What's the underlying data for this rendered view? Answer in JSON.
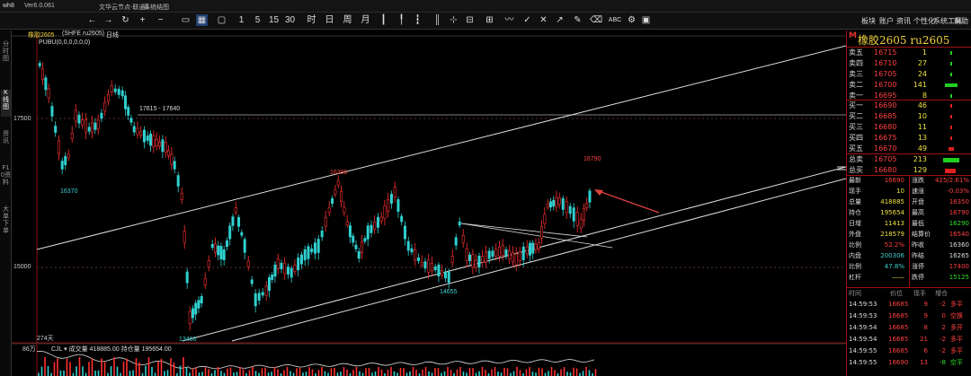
{
  "topbar": {
    "title": "wh8",
    "version": "Ver6.0.061",
    "menus": [
      "文华云节点-联通3",
      "系统结图"
    ]
  },
  "toolbar": {
    "right_menu": [
      "板块",
      "账户",
      "资讯",
      "个性化",
      "系统工具",
      "帮助"
    ]
  },
  "sidebar": {
    "tabs": [
      "分时图",
      "K线图",
      "资讯",
      "F10资料",
      "大单下单"
    ]
  },
  "chart": {
    "header": "橡胶2605",
    "header_code": "(SHFE ru2605)",
    "period": "日线",
    "indicator": "PUBU(0,0,0,0,0,0)",
    "price_labels": [
      "17500",
      "15000"
    ],
    "annotations": {
      "resistance": "17615 - 17640",
      "low_left": "16370",
      "high_mid": "16390",
      "low_mid": "14655",
      "high_right": "16790",
      "low_bottom": "13460"
    },
    "bottom_label": "274天",
    "volume_header": "86万",
    "volume_info": "CJL ▾ 成交量 418885.00  持仓量 195654.00"
  },
  "chart_data": {
    "type": "candlestick",
    "title": "橡胶2605",
    "x": [],
    "y_labels": [
      "17500",
      "15000"
    ],
    "annotations": [
      "17615 - 17640",
      "16370",
      "16390",
      "14655",
      "16790",
      "13460"
    ]
  },
  "panel": {
    "marker": "M",
    "title": "橡胶2605 ru2605",
    "asks": [
      {
        "label": "卖五",
        "price": "16715",
        "vol": "1"
      },
      {
        "label": "卖四",
        "price": "16710",
        "vol": "27"
      },
      {
        "label": "卖三",
        "price": "16705",
        "vol": "24"
      },
      {
        "label": "卖二",
        "price": "16700",
        "vol": "141"
      },
      {
        "label": "卖一",
        "price": "16695",
        "vol": "8"
      }
    ],
    "bids": [
      {
        "label": "买一",
        "price": "16690",
        "vol": "46"
      },
      {
        "label": "买二",
        "price": "16685",
        "vol": "10"
      },
      {
        "label": "买三",
        "price": "16680",
        "vol": "11"
      },
      {
        "label": "买四",
        "price": "16675",
        "vol": "13"
      },
      {
        "label": "买五",
        "price": "16670",
        "vol": "49"
      }
    ],
    "totals": [
      {
        "label": "总卖",
        "price": "16705",
        "vol": "213"
      },
      {
        "label": "总买",
        "price": "16680",
        "vol": "129"
      }
    ],
    "quote": [
      {
        "l1": "最新",
        "v1": "16690",
        "l2": "涨跌",
        "v2": "425/2.61%"
      },
      {
        "l1": "现手",
        "v1": "10",
        "l2": "速涨",
        "v2": "-0.03%"
      },
      {
        "l1": "总量",
        "v1": "418885",
        "l2": "开盘",
        "v2": "16350"
      },
      {
        "l1": "持仓",
        "v1": "195654",
        "l2": "最高",
        "v2": "16790"
      },
      {
        "l1": "日增",
        "v1": "11413",
        "l2": "最低",
        "v2": "16290"
      },
      {
        "l1": "外盘",
        "v1": "218579",
        "l2": "结算价",
        "v2": "16540"
      },
      {
        "l1": "比例",
        "v1": "52.2%",
        "l2": "昨收",
        "v2": "16360"
      },
      {
        "l1": "内盘",
        "v1": "200306",
        "l2": "昨结",
        "v2": "16265"
      },
      {
        "l1": "比例",
        "v1": "47.8%",
        "l2": "涨停",
        "v2": "17400"
      },
      {
        "l1": "杠杆",
        "v1": "——",
        "l2": "跌停",
        "v2": "15125"
      }
    ],
    "trades_header": [
      "时间",
      "价位",
      "现手",
      "增仓"
    ],
    "trades": [
      {
        "time": "14:59:53",
        "price": "16685",
        "vol": "9",
        "chg": "-2",
        "type": "多平"
      },
      {
        "time": "14:59:53",
        "price": "16685",
        "vol": "9",
        "chg": "0",
        "type": "空换"
      },
      {
        "time": "14:59:54",
        "price": "16685",
        "vol": "8",
        "chg": "2",
        "type": "多开"
      },
      {
        "time": "14:59:54",
        "price": "16685",
        "vol": "21",
        "chg": "-2",
        "type": "多平"
      },
      {
        "time": "14:59:55",
        "price": "16685",
        "vol": "6",
        "chg": "-2",
        "type": "多平"
      },
      {
        "time": "14:59:55",
        "price": "16690",
        "vol": "13",
        "chg": "-8",
        "type": "空平"
      }
    ]
  }
}
